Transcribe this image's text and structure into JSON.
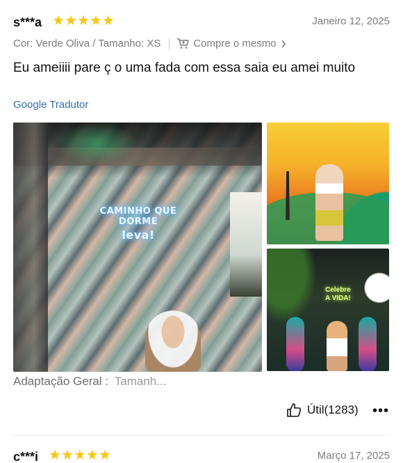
{
  "review_1": {
    "username": "s***a",
    "stars": 5,
    "date": "Janeiro 12, 2025",
    "variant": "Cor: Verde Oliva / Tamanho: XS",
    "buy_same": "Compre o mesmo",
    "text": "Eu ameiiii pare ç o uma fada com essa saia eu amei muito",
    "translate": "Google Tradutor",
    "neon_line1": "CAMINHO QUE DORME",
    "neon_line2": "leva!",
    "neon_sign2_line1": "Celebre",
    "neon_sign2_line2": "A VIDA!",
    "fit_label": "Adaptação Geral :",
    "fit_value": "Tamanh...",
    "helpful_label": "Útil(1283)",
    "more": "•••"
  },
  "review_2": {
    "username": "c***i",
    "stars": 5,
    "date": "Março 17, 2025"
  },
  "colors": {
    "star": "#f6c613",
    "link": "#2f6ea8",
    "muted": "#7b7b7b"
  }
}
